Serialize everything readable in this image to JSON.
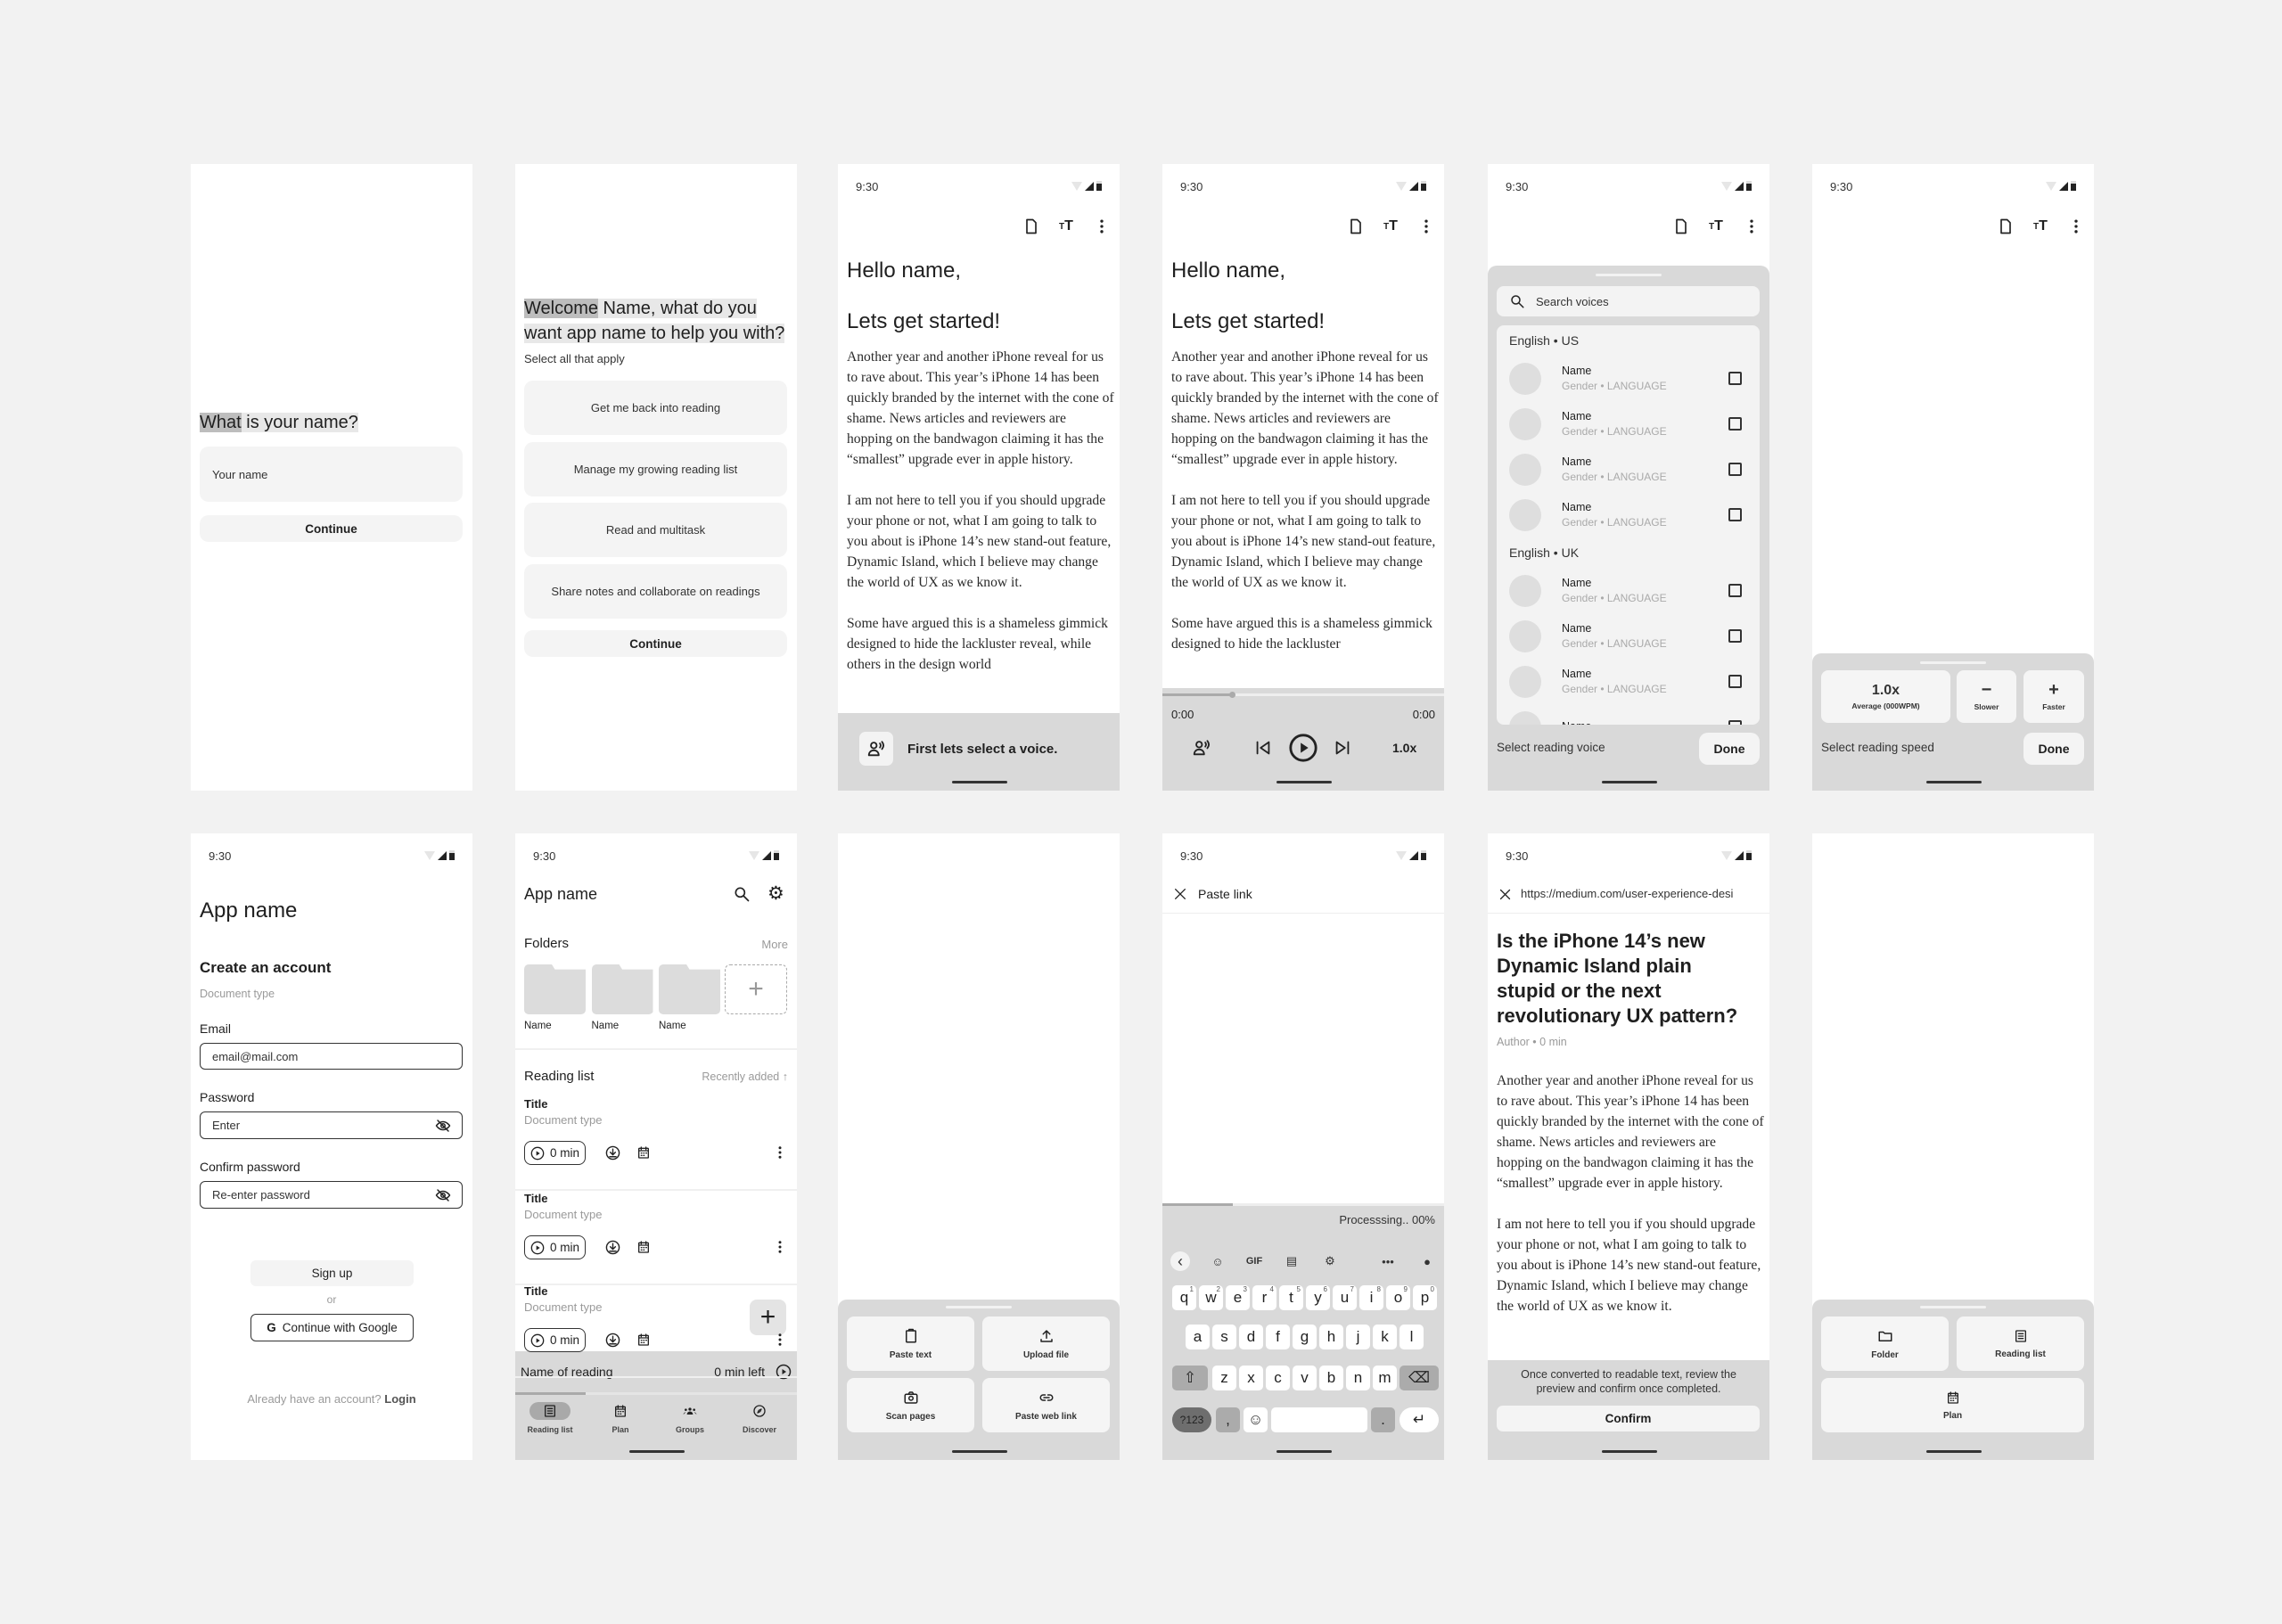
{
  "status_time": "9:30",
  "colors": {
    "background": "#f2f2f2",
    "sheet": "#d9d9d9",
    "surface": "#f5f5f5",
    "text": "#1f1f1f",
    "muted": "#9a9a9a"
  },
  "reader_toolbar": {
    "icons": [
      "document-icon",
      "text-size-icon",
      "more-vertical-icon"
    ]
  },
  "screens": {
    "name_entry": {
      "heading_highlight": "What",
      "heading_rest": " is your name?",
      "input_placeholder": "Your name",
      "continue": "Continue"
    },
    "goals": {
      "heading_highlight": "Welcome",
      "heading_rest_line1": " Name, what do you",
      "heading_line2": "want app name to help you with?",
      "subheading": "Select all that apply",
      "options": [
        "Get me back into reading",
        "Manage my growing reading list",
        "Read and multitask",
        "Share notes and collaborate on readings"
      ],
      "continue": "Continue"
    },
    "reader_intro": {
      "greeting": "Hello name,",
      "title": "Lets get started!",
      "paragraphs": [
        "Another year and another iPhone reveal for us to rave about. This year’s iPhone 14 has been quickly branded by the internet with the cone of shame. News articles and reviewers are hopping on the bandwagon claiming it has the “smallest” upgrade ever in apple history.",
        "I am not here to tell you if you should upgrade your phone or not, what I am going to talk to you about is iPhone 14’s new stand-out feature, Dynamic Island, which I believe may change the world of UX as we know it.",
        "Some have argued this is a shameless gimmick designed to hide the lackluster reveal, while others in the design world"
      ],
      "voice_prompt": "First lets select a voice."
    },
    "reader_player": {
      "greeting": "Hello name,",
      "title": "Lets get started!",
      "paragraphs": [
        "Another year and another iPhone reveal for us to rave about. This year’s iPhone 14 has been quickly branded by the internet with the cone of shame. News articles and reviewers are hopping on the bandwagon claiming it has the “smallest” upgrade ever in apple history.",
        "I am not here to tell you if you should upgrade your phone or not, what I am going to talk to you about is iPhone 14’s new stand-out feature, Dynamic Island, which I believe may change the world of UX as we know it.",
        "Some have argued this is a shameless gimmick designed to hide the lackluster"
      ],
      "elapsed": "0:00",
      "total": "0:00",
      "speed": "1.0x",
      "progress": 0.25
    },
    "voice_picker": {
      "search_placeholder": "Search voices",
      "groups": [
        {
          "label": "English • US",
          "voices": [
            {
              "name": "Name",
              "meta": "Gender • LANGUAGE",
              "checked": false
            },
            {
              "name": "Name",
              "meta": "Gender • LANGUAGE",
              "checked": false
            },
            {
              "name": "Name",
              "meta": "Gender • LANGUAGE",
              "checked": false
            },
            {
              "name": "Name",
              "meta": "Gender • LANGUAGE",
              "checked": false
            }
          ]
        },
        {
          "label": "English • UK",
          "voices": [
            {
              "name": "Name",
              "meta": "Gender • LANGUAGE",
              "checked": false
            },
            {
              "name": "Name",
              "meta": "Gender • LANGUAGE",
              "checked": false
            },
            {
              "name": "Name",
              "meta": "Gender • LANGUAGE",
              "checked": false
            },
            {
              "name": "Name",
              "meta": "",
              "checked": false
            }
          ]
        }
      ],
      "footer_label": "Select reading voice",
      "done": "Done"
    },
    "speed_picker": {
      "speed": "1.0x",
      "speed_caption": "Average (000WPM)",
      "slower": "Slower",
      "faster": "Faster",
      "footer_label": "Select reading speed",
      "done": "Done"
    },
    "signup": {
      "app_name": "App name",
      "title": "Create an account",
      "subtitle": "Document type",
      "email_label": "Email",
      "email_value": "email@mail.com",
      "password_label": "Password",
      "password_placeholder": "Enter",
      "confirm_label": "Confirm password",
      "confirm_placeholder": "Re-enter password",
      "sign_up": "Sign up",
      "or": "or",
      "google": "Continue with Google",
      "have_account": "Already have an account?",
      "login": "Login"
    },
    "home": {
      "app_name": "App name",
      "folders_label": "Folders",
      "more": "More",
      "folders": [
        "Name",
        "Name",
        "Name"
      ],
      "reading_list_label": "Reading list",
      "sort": "Recently added",
      "items": [
        {
          "title": "Title",
          "type": "Document type",
          "duration": "0 min"
        },
        {
          "title": "Title",
          "type": "Document type",
          "duration": "0 min"
        },
        {
          "title": "Title",
          "type": "Document type",
          "duration": "0 min"
        }
      ],
      "now_playing": {
        "name": "Name of reading",
        "remaining": "0 min left",
        "progress": 0.25
      },
      "nav": [
        {
          "label": "Reading list",
          "icon": "list-icon",
          "active": true
        },
        {
          "label": "Plan",
          "icon": "calendar-icon",
          "active": false
        },
        {
          "label": "Groups",
          "icon": "groups-icon",
          "active": false
        },
        {
          "label": "Discover",
          "icon": "compass-icon",
          "active": false
        }
      ]
    },
    "add_menu": {
      "options": [
        {
          "label": "Paste text",
          "icon": "clipboard-icon"
        },
        {
          "label": "Upload file",
          "icon": "upload-icon"
        },
        {
          "label": "Scan pages",
          "icon": "camera-icon"
        },
        {
          "label": "Paste web link",
          "icon": "link-icon"
        }
      ]
    },
    "paste_link": {
      "title": "Paste link",
      "processing": "Processsing.. 00%",
      "progress": 0.25,
      "gif": "GIF",
      "row1": [
        "q",
        "w",
        "e",
        "r",
        "t",
        "y",
        "u",
        "i",
        "o",
        "p"
      ],
      "row1_hints": [
        "1",
        "2",
        "3",
        "4",
        "5",
        "6",
        "7",
        "8",
        "9",
        "0"
      ],
      "row2": [
        "a",
        "s",
        "d",
        "f",
        "g",
        "h",
        "j",
        "k",
        "l"
      ],
      "row3": [
        "z",
        "x",
        "c",
        "v",
        "b",
        "n",
        "m"
      ],
      "num_key": "?123",
      "comma": ",",
      "period": "."
    },
    "preview": {
      "url": "https://medium.com/user-experience-desi",
      "title": "Is the iPhone 14’s new Dynamic Island plain stupid or the next revolutionary UX pattern?",
      "meta": "Author • 0 min",
      "paragraphs": [
        "Another year and another iPhone reveal for us to rave about. This year’s iPhone 14 has been quickly branded by the internet with the cone of shame. News articles and reviewers are hopping on the bandwagon claiming it has the “smallest” upgrade ever in apple history.",
        "I am not here to tell you if you should upgrade your phone or not, what I am going to talk to you about is iPhone 14’s new stand-out feature, Dynamic Island, which I believe may change the world of UX as we know it."
      ],
      "notice": "Once converted to readable text, review the preview and confirm once completed.",
      "confirm": "Confirm"
    },
    "save_menu": {
      "options": [
        {
          "label": "Folder",
          "icon": "folder-icon"
        },
        {
          "label": "Reading list",
          "icon": "list-icon"
        },
        {
          "label": "Plan",
          "icon": "calendar-icon"
        }
      ]
    }
  }
}
